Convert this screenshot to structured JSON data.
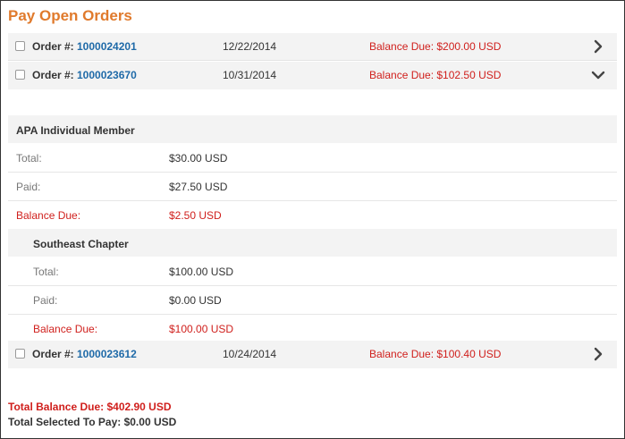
{
  "title": "Pay Open Orders",
  "colors": {
    "title": "#e07a2c",
    "link": "#1f6aa8",
    "balance_due": "#d0201d",
    "row_background": "#f3f3f3"
  },
  "order_label": "Order #:",
  "orders": [
    {
      "number": "1000024201",
      "date": "12/22/2014",
      "balance": "Balance Due: $200.00 USD",
      "checked": false,
      "expand_icon": "chevron-right-icon"
    },
    {
      "number": "1000023670",
      "date": "10/31/2014",
      "balance": "Balance Due: $102.50 USD",
      "checked": false,
      "expand_icon": "chevron-down-icon"
    },
    {
      "number": "1000023612",
      "date": "10/24/2014",
      "balance": "Balance Due: $100.40 USD",
      "checked": false,
      "expand_icon": "chevron-right-icon"
    }
  ],
  "order_details": [
    {
      "name": "APA Individual Member",
      "total_label": "Total:",
      "total": "$30.00 USD",
      "paid_label": "Paid:",
      "paid": "$27.50 USD",
      "balance_label": "Balance Due:",
      "balance": "$2.50 USD"
    },
    {
      "name": "Southeast Chapter",
      "total_label": "Total:",
      "total": "$100.00 USD",
      "paid_label": "Paid:",
      "paid": "$0.00 USD",
      "balance_label": "Balance Due:",
      "balance": "$100.00 USD"
    }
  ],
  "summary": {
    "total_balance_due": "Total Balance Due: $402.90 USD",
    "total_selected": "Total Selected To Pay: $0.00 USD"
  }
}
